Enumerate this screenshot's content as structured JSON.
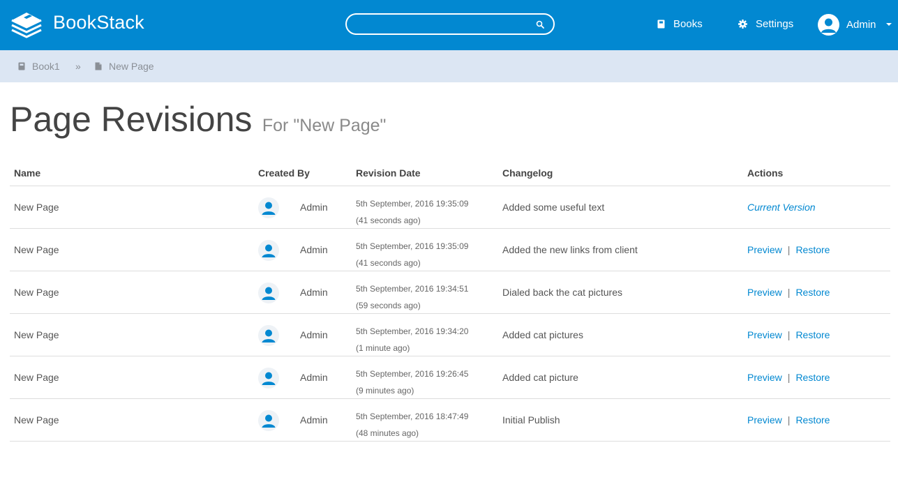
{
  "app": {
    "brand": "BookStack",
    "accent": "#0288D1"
  },
  "header": {
    "search_placeholder": "",
    "nav": {
      "books": "Books",
      "settings": "Settings"
    },
    "user": "Admin"
  },
  "breadcrumbs": {
    "book": "Book1",
    "separator": "»",
    "page": "New Page"
  },
  "title": {
    "main": "Page Revisions",
    "sub": "For \"New Page\""
  },
  "table": {
    "columns": [
      "Name",
      "Created By",
      "Revision Date",
      "Changelog",
      "Actions"
    ],
    "rows": [
      {
        "name": "New Page",
        "user": "Admin",
        "date": "5th September, 2016 19:35:09",
        "ago": "(41 seconds ago)",
        "changelog": "Added some useful text",
        "current": "Current Version",
        "preview": "",
        "restore": ""
      },
      {
        "name": "New Page",
        "user": "Admin",
        "date": "5th September, 2016 19:35:09",
        "ago": "(41 seconds ago)",
        "changelog": "Added the new links from client",
        "current": "",
        "preview": "Preview",
        "restore": "Restore"
      },
      {
        "name": "New Page",
        "user": "Admin",
        "date": "5th September, 2016 19:34:51",
        "ago": "(59 seconds ago)",
        "changelog": "Dialed back the cat pictures",
        "current": "",
        "preview": "Preview",
        "restore": "Restore"
      },
      {
        "name": "New Page",
        "user": "Admin",
        "date": "5th September, 2016 19:34:20",
        "ago": "(1 minute ago)",
        "changelog": "Added cat pictures",
        "current": "",
        "preview": "Preview",
        "restore": "Restore"
      },
      {
        "name": "New Page",
        "user": "Admin",
        "date": "5th September, 2016 19:26:45",
        "ago": "(9 minutes ago)",
        "changelog": "Added cat picture",
        "current": "",
        "preview": "Preview",
        "restore": "Restore"
      },
      {
        "name": "New Page",
        "user": "Admin",
        "date": "5th September, 2016 18:47:49",
        "ago": "(48 minutes ago)",
        "changelog": "Initial Publish",
        "current": "",
        "preview": "Preview",
        "restore": "Restore"
      }
    ],
    "action_separator": "|"
  }
}
